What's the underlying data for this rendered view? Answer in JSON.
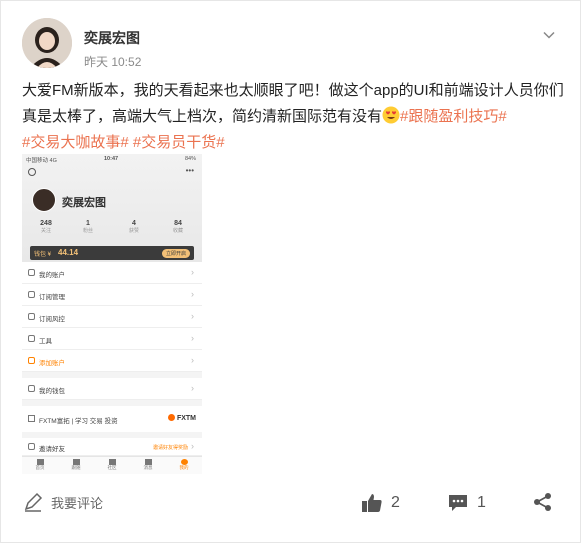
{
  "post": {
    "author": "奕展宏图",
    "time": "昨天 10:52",
    "text_main": "大爱FM新版本，我的天看起来也太顺眼了吧！做这个app的UI和前端设计人员你们真是太棒了，高端大气上档次，简约清新国际范有没有",
    "tag1": "#跟随盈利技巧#",
    "tag2": "#交易大咖故事#",
    "tag3": "#交易员干货#",
    "emoji": "smiling-face-with-heart-eyes-emoji"
  },
  "phone": {
    "status_left": "中国移动 4G",
    "status_time": "10:47",
    "status_right": "84%",
    "more": "•••",
    "profile_name": "奕展宏图",
    "stats": [
      {
        "value": "248",
        "label": "关注"
      },
      {
        "value": "1",
        "label": "粉丝"
      },
      {
        "value": "4",
        "label": "获赞"
      },
      {
        "value": "84",
        "label": "收藏"
      }
    ],
    "balance_label": "钱包 ¥",
    "balance_value": "44.14",
    "balance_btn": "立即开启",
    "menu": [
      {
        "label": "我的账户"
      },
      {
        "label": "订阅管理"
      },
      {
        "label": "订阅风控"
      },
      {
        "label": "工具"
      },
      {
        "label": "添加账户",
        "highlight": true
      },
      {
        "label": "我的钱包"
      }
    ],
    "promo_text": "FXTM富拓 | 学习 交易 投资",
    "promo_logo": "FXTM",
    "invite_label": "邀请好友",
    "invite_hint": "邀请好友得奖励",
    "tabs": [
      "首页",
      "跟随",
      "社区",
      "消息",
      "我的"
    ]
  },
  "footer": {
    "comment_placeholder": "我要评论",
    "like_count": "2",
    "comment_count": "1"
  },
  "colors": {
    "tag": "#eb7350",
    "accent": "#ff8200"
  }
}
